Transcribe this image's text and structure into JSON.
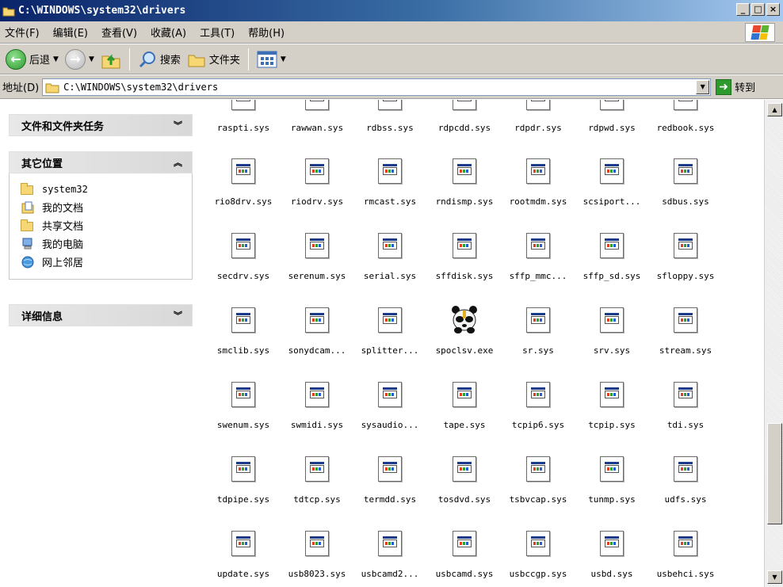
{
  "window": {
    "title": "C:\\WINDOWS\\system32\\drivers",
    "min_label": "_",
    "max_label": "□",
    "close_label": "×"
  },
  "menu": [
    "文件(F)",
    "编辑(E)",
    "查看(V)",
    "收藏(A)",
    "工具(T)",
    "帮助(H)"
  ],
  "toolbar": {
    "back_label": "后退",
    "search_label": "搜索",
    "folders_label": "文件夹"
  },
  "address": {
    "label": "地址(D)",
    "value": "C:\\WINDOWS\\system32\\drivers",
    "go_label": "转到"
  },
  "left_panel": {
    "tasks_header": "文件和文件夹任务",
    "other_places_header": "其它位置",
    "details_header": "详细信息",
    "places": [
      {
        "label": "system32",
        "icon": "folder-icon"
      },
      {
        "label": "我的文档",
        "icon": "my-documents-icon"
      },
      {
        "label": "共享文档",
        "icon": "folder-icon"
      },
      {
        "label": "我的电脑",
        "icon": "my-computer-icon"
      },
      {
        "label": "网上邻居",
        "icon": "network-places-icon"
      }
    ]
  },
  "files": {
    "row0": [
      "raspti.sys",
      "rawwan.sys",
      "rdbss.sys",
      "rdpcdd.sys",
      "rdpdr.sys",
      "rdpwd.sys",
      "redbook.sys"
    ],
    "row1": [
      "rio8drv.sys",
      "riodrv.sys",
      "rmcast.sys",
      "rndismp.sys",
      "rootmdm.sys",
      "scsiport...",
      "sdbus.sys"
    ],
    "row2": [
      "secdrv.sys",
      "serenum.sys",
      "serial.sys",
      "sffdisk.sys",
      "sffp_mmc...",
      "sffp_sd.sys",
      "sfloppy.sys"
    ],
    "row3": [
      "smclib.sys",
      "sonydcam...",
      "splitter...",
      "spoclsv.exe",
      "sr.sys",
      "srv.sys",
      "stream.sys"
    ],
    "row4": [
      "swenum.sys",
      "swmidi.sys",
      "sysaudio...",
      "tape.sys",
      "tcpip6.sys",
      "tcpip.sys",
      "tdi.sys"
    ],
    "row5": [
      "tdpipe.sys",
      "tdtcp.sys",
      "termdd.sys",
      "tosdvd.sys",
      "tsbvcap.sys",
      "tunmp.sys",
      "udfs.sys"
    ],
    "row6": [
      "update.sys",
      "usb8023.sys",
      "usbcamd2...",
      "usbcamd.sys",
      "usbccgp.sys",
      "usbd.sys",
      "usbehci.sys"
    ]
  },
  "colors": {
    "titlebar_start": "#0a246a",
    "chrome": "#d4d0c8",
    "folder": "#f7d774"
  }
}
